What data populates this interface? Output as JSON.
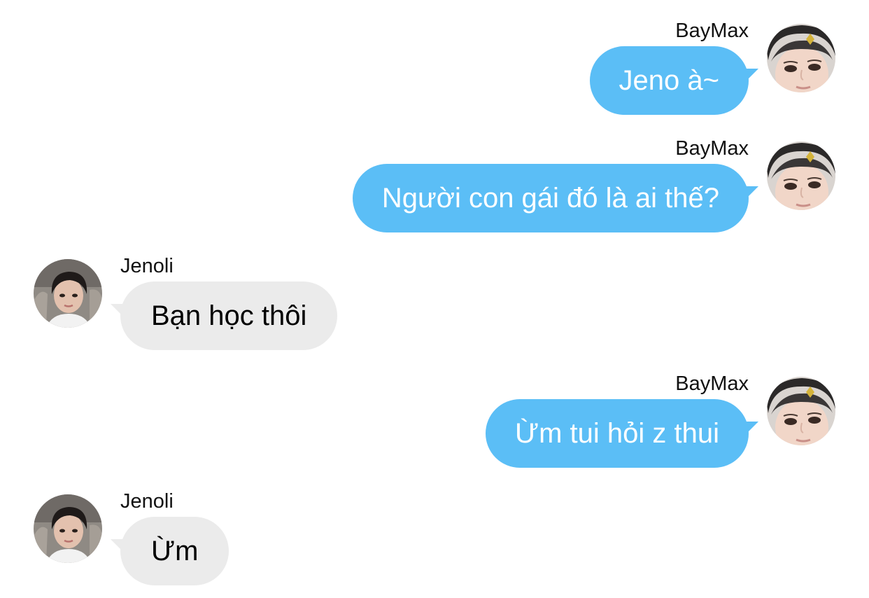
{
  "colors": {
    "outgoing_bubble": "#5bbef6",
    "incoming_bubble": "#ebebeb",
    "outgoing_text": "#ffffff",
    "incoming_text": "#000000"
  },
  "messages": [
    {
      "sender": "BayMax",
      "side": "outgoing",
      "avatar": "baymax-avatar",
      "text": "Jeno à~"
    },
    {
      "sender": "BayMax",
      "side": "outgoing",
      "avatar": "baymax-avatar",
      "text": "Người con gái đó là ai thế?"
    },
    {
      "sender": "Jenoli",
      "side": "incoming",
      "avatar": "jenoli-avatar",
      "text": "Bạn học thôi"
    },
    {
      "sender": "BayMax",
      "side": "outgoing",
      "avatar": "baymax-avatar",
      "text": "Ừm tui hỏi z thui"
    },
    {
      "sender": "Jenoli",
      "side": "incoming",
      "avatar": "jenoli-avatar",
      "text": "Ừm"
    }
  ]
}
